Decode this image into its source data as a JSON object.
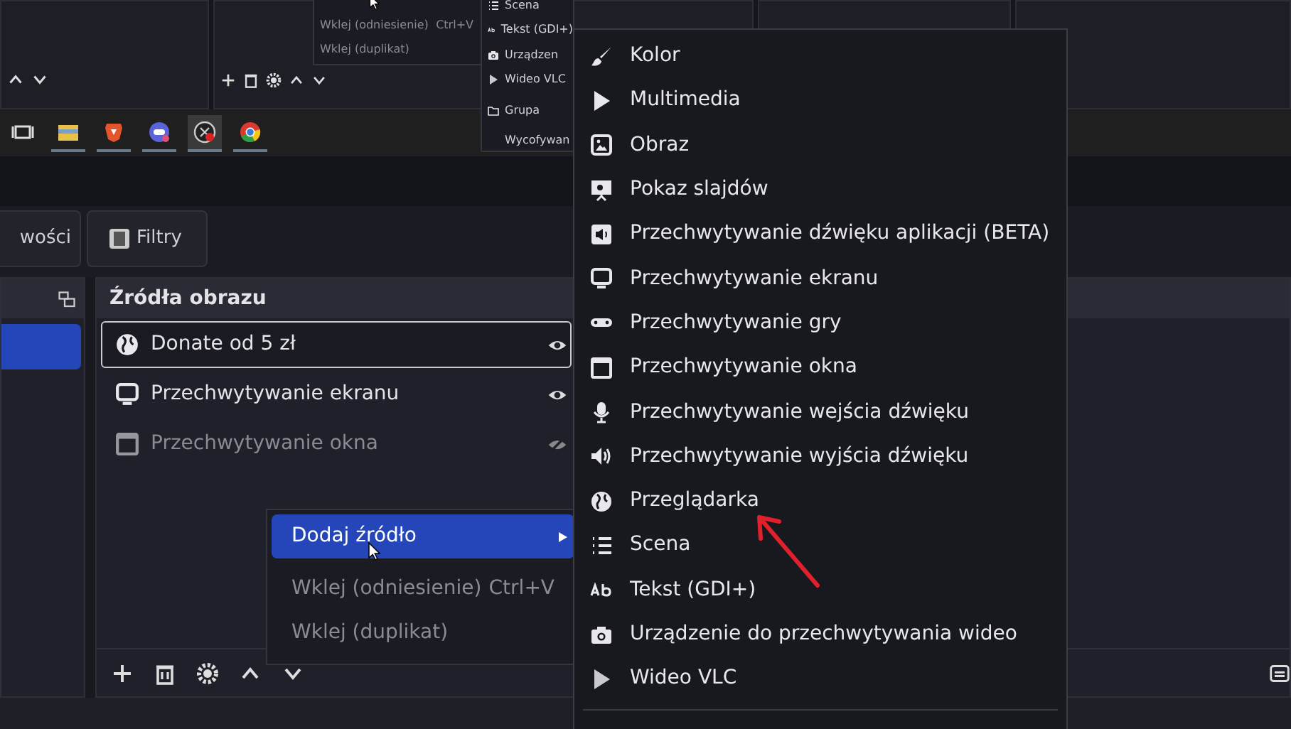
{
  "inset": {
    "context_menu": {
      "items": [
        {
          "label": "Wklej (odniesienie)",
          "shortcut": "Ctrl+V",
          "disabled": true
        },
        {
          "label": "Wklej (duplikat)",
          "disabled": true
        }
      ]
    },
    "submenu": {
      "items": [
        {
          "label": "Scena",
          "kind": "scene"
        },
        {
          "label": "Tekst (GDI+)",
          "kind": "text"
        },
        {
          "label": "Urządzen",
          "kind": "camera"
        },
        {
          "label": "Wideo VLC",
          "kind": "vlc"
        },
        {
          "label": "Grupa",
          "kind": "group"
        },
        {
          "label": "Wycofywan",
          "kind": "plain"
        }
      ]
    }
  },
  "taskbar": {
    "apps": [
      {
        "kind": "taskview",
        "selected": false
      },
      {
        "kind": "folder",
        "selected": false
      },
      {
        "kind": "shield",
        "selected": false
      },
      {
        "kind": "round",
        "selected": false
      },
      {
        "kind": "record",
        "selected": true
      },
      {
        "kind": "chrome",
        "selected": false
      }
    ]
  },
  "tabs": [
    {
      "label": "wości",
      "kind": "plain"
    },
    {
      "label": "Filtry",
      "kind": "filters"
    }
  ],
  "scenes": [
    {
      "selected": true
    }
  ],
  "sources": {
    "title": "Źródła obrazu",
    "items": [
      {
        "label": "Donate od 5 zł",
        "kind": "browser",
        "selected": true,
        "visible": true
      },
      {
        "label": "Przechwytywanie ekranu",
        "kind": "display",
        "selected": false,
        "visible": true
      },
      {
        "label": "Przechwytywanie okna",
        "kind": "window",
        "selected": false,
        "visible": false
      }
    ]
  },
  "context_menu": {
    "items": [
      {
        "label": "Dodaj źródło",
        "selected": true,
        "submenu": true,
        "disabled": false
      },
      {
        "label": "Wklej (odniesienie)",
        "shortcut": "Ctrl+V",
        "selected": false,
        "submenu": false,
        "disabled": true
      },
      {
        "label": "Wklej (duplikat)",
        "selected": false,
        "submenu": false,
        "disabled": true
      }
    ]
  },
  "submenu": {
    "items": [
      {
        "label": "Kolor",
        "kind": "color"
      },
      {
        "label": "Multimedia",
        "kind": "media"
      },
      {
        "label": "Obraz",
        "kind": "image"
      },
      {
        "label": "Pokaz slajdów",
        "kind": "slideshow"
      },
      {
        "label": "Przechwytywanie dźwięku aplikacji (BETA)",
        "kind": "appaudio"
      },
      {
        "label": "Przechwytywanie ekranu",
        "kind": "display"
      },
      {
        "label": "Przechwytywanie gry",
        "kind": "game"
      },
      {
        "label": "Przechwytywanie okna",
        "kind": "window"
      },
      {
        "label": "Przechwytywanie wejścia dźwięku",
        "kind": "mic"
      },
      {
        "label": "Przechwytywanie wyjścia dźwięku",
        "kind": "speaker"
      },
      {
        "label": "Przeglądarka",
        "kind": "browser"
      },
      {
        "label": "Scena",
        "kind": "scene"
      },
      {
        "label": "Tekst (GDI+)",
        "kind": "text"
      },
      {
        "label": "Urządzenie do przechwytywania wideo",
        "kind": "camera"
      },
      {
        "label": "Wideo VLC",
        "kind": "vlc"
      }
    ]
  }
}
